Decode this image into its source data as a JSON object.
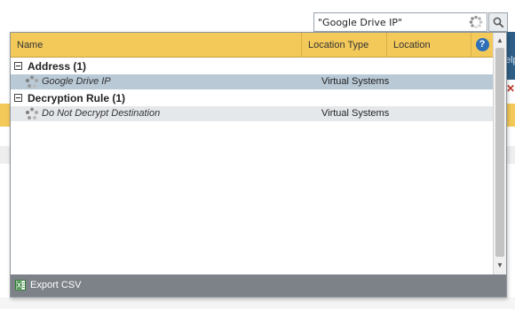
{
  "search": {
    "value": "\"Google Drive IP\"",
    "button_icon": "search-icon"
  },
  "background": {
    "partial_text": "elp",
    "close_glyph": "✕"
  },
  "grid": {
    "columns": [
      {
        "label": "Name"
      },
      {
        "label": "Location Type"
      },
      {
        "label": "Location"
      }
    ],
    "help_label": "?",
    "groups": [
      {
        "label": "Address (1)",
        "rows": [
          {
            "name": "Google Drive IP",
            "location_type": "Virtual Systems",
            "location": "",
            "selected": true,
            "icon": "address-object-icon"
          }
        ]
      },
      {
        "label": "Decryption Rule (1)",
        "rows": [
          {
            "name": "Do Not Decrypt Destination",
            "location_type": "Virtual Systems",
            "location": "",
            "selected": false,
            "icon": "rule-icon"
          }
        ]
      }
    ]
  },
  "footer": {
    "export_label": "Export CSV",
    "export_icon": "excel-icon"
  },
  "colors": {
    "header": "#f3c95a",
    "selected_row": "#b9c9d6",
    "footer": "#7d8289",
    "help": "#2d6fb8"
  }
}
